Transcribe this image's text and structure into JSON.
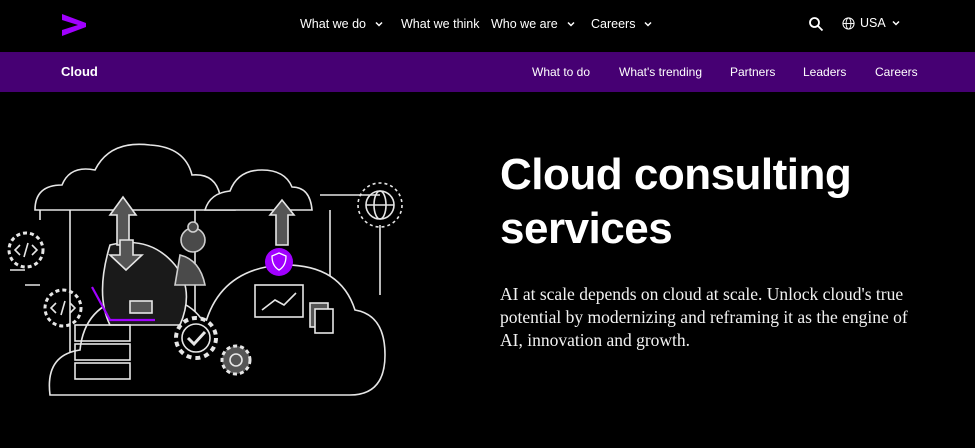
{
  "topnav": {
    "items": [
      {
        "label": "What we do",
        "dropdown": true
      },
      {
        "label": "What we think",
        "dropdown": false
      },
      {
        "label": "Who we are",
        "dropdown": true
      },
      {
        "label": "Careers",
        "dropdown": true
      }
    ],
    "locale": "USA"
  },
  "subnav": {
    "title": "Cloud",
    "items": [
      "What to do",
      "What's trending",
      "Partners",
      "Leaders",
      "Careers"
    ]
  },
  "hero": {
    "title_line1": "Cloud consulting",
    "title_line2": "services",
    "description": "AI at scale depends on cloud at scale. Unlock cloud's true potential by modernizing and reframing it as the engine of AI, innovation and growth."
  },
  "colors": {
    "brand_purple": "#a100ff",
    "subnav_bg": "#460073",
    "background": "#000000"
  },
  "icons": [
    "accenture-logo-icon",
    "chevron-down-icon",
    "search-icon",
    "globe-icon"
  ]
}
